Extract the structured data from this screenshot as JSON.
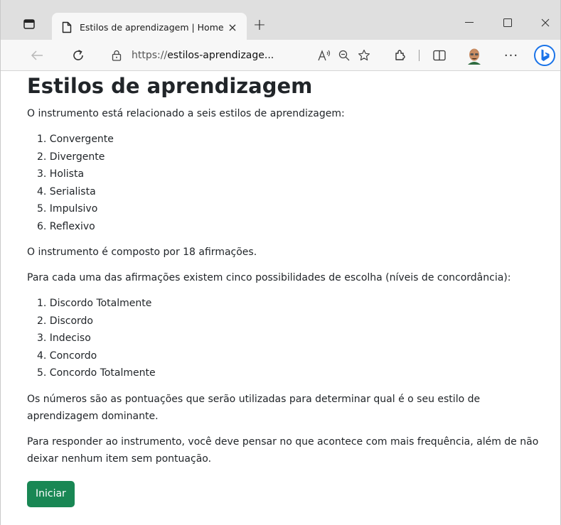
{
  "browser": {
    "tab_title": "Estilos de aprendizagem | Home",
    "tab_close": "×",
    "new_tab": "+",
    "url_scheme": "https://",
    "url_host": "estilos-aprendizage...",
    "more_label": "···",
    "accent": "#1a73e8"
  },
  "page": {
    "title": "Estilos de aprendizagem",
    "intro": "O instrumento está relacionado a seis estilos de aprendizagem:",
    "styles": [
      "1. Convergente",
      "2. Divergente",
      "3. Holista",
      "4. Serialista",
      "5. Impulsivo",
      "6. Reflexivo"
    ],
    "statement_count": "O instrumento é composto por 18 afirmações.",
    "choices_intro": "Para cada uma das afirmações existem cinco possibilidades de escolha (níveis de concordância):",
    "choices": [
      "1. Discordo Totalmente",
      "2. Discordo",
      "3. Indeciso",
      "4. Concordo",
      "5. Concordo Totalmente"
    ],
    "scores_note": "Os números são as pontuações que serão utilizadas para determinar qual é o seu estilo de aprendizagem dominante.",
    "instructions": "Para responder ao instrumento, você deve pensar no que acontece com mais frequência, além de não deixar nenhum item sem pontuação.",
    "start_button": "Iniciar",
    "button_color": "#198754"
  }
}
